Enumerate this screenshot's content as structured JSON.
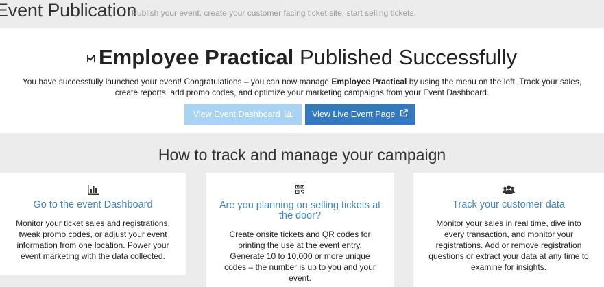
{
  "header": {
    "title": "Event Publication",
    "subtitle": "Publish your event, create your customer facing ticket site, start selling tickets."
  },
  "success": {
    "event_name": "Employee Practical",
    "published_text": "Published Successfully",
    "message_part1": "You have successfully launched your event! Congratulations – you can now manage ",
    "message_event_name": "Employee Practical",
    "message_part2": " by using the menu on the left. Track your sales, create reports, add promo codes, and optimize your marketing campaigns from your Event Dashboard.",
    "dashboard_button_label": "View Event Dashboard",
    "live_button_label": "View Live Event Page"
  },
  "campaign": {
    "heading": "How to track and manage your campaign",
    "cards": [
      {
        "icon": "bar-chart-icon",
        "title": "Go to the event Dashboard",
        "body": "Monitor your ticket sales and registrations, tweak promo codes, or adjust your event information from one location. Power your event marketing with the data collected."
      },
      {
        "icon": "qr-code-icon",
        "title": "Are you planning on selling tickets at the door?",
        "body": "Create onsite tickets and QR codes for printing the use at the event entry. Generate 10 to 10,000 or more unique codes – the number is up to you and your event."
      },
      {
        "icon": "users-icon",
        "title": "Track your customer data",
        "body": "Monitor your sales in real time, dive into every transaction, and monitor your registrations. Add or remove registration questions or extract your data at any time to examine for insights."
      }
    ]
  },
  "colors": {
    "background": "#ececec",
    "link_blue": "#3b86c6",
    "button_light_blue": "#a9d3f2",
    "button_blue": "#3479bf"
  }
}
